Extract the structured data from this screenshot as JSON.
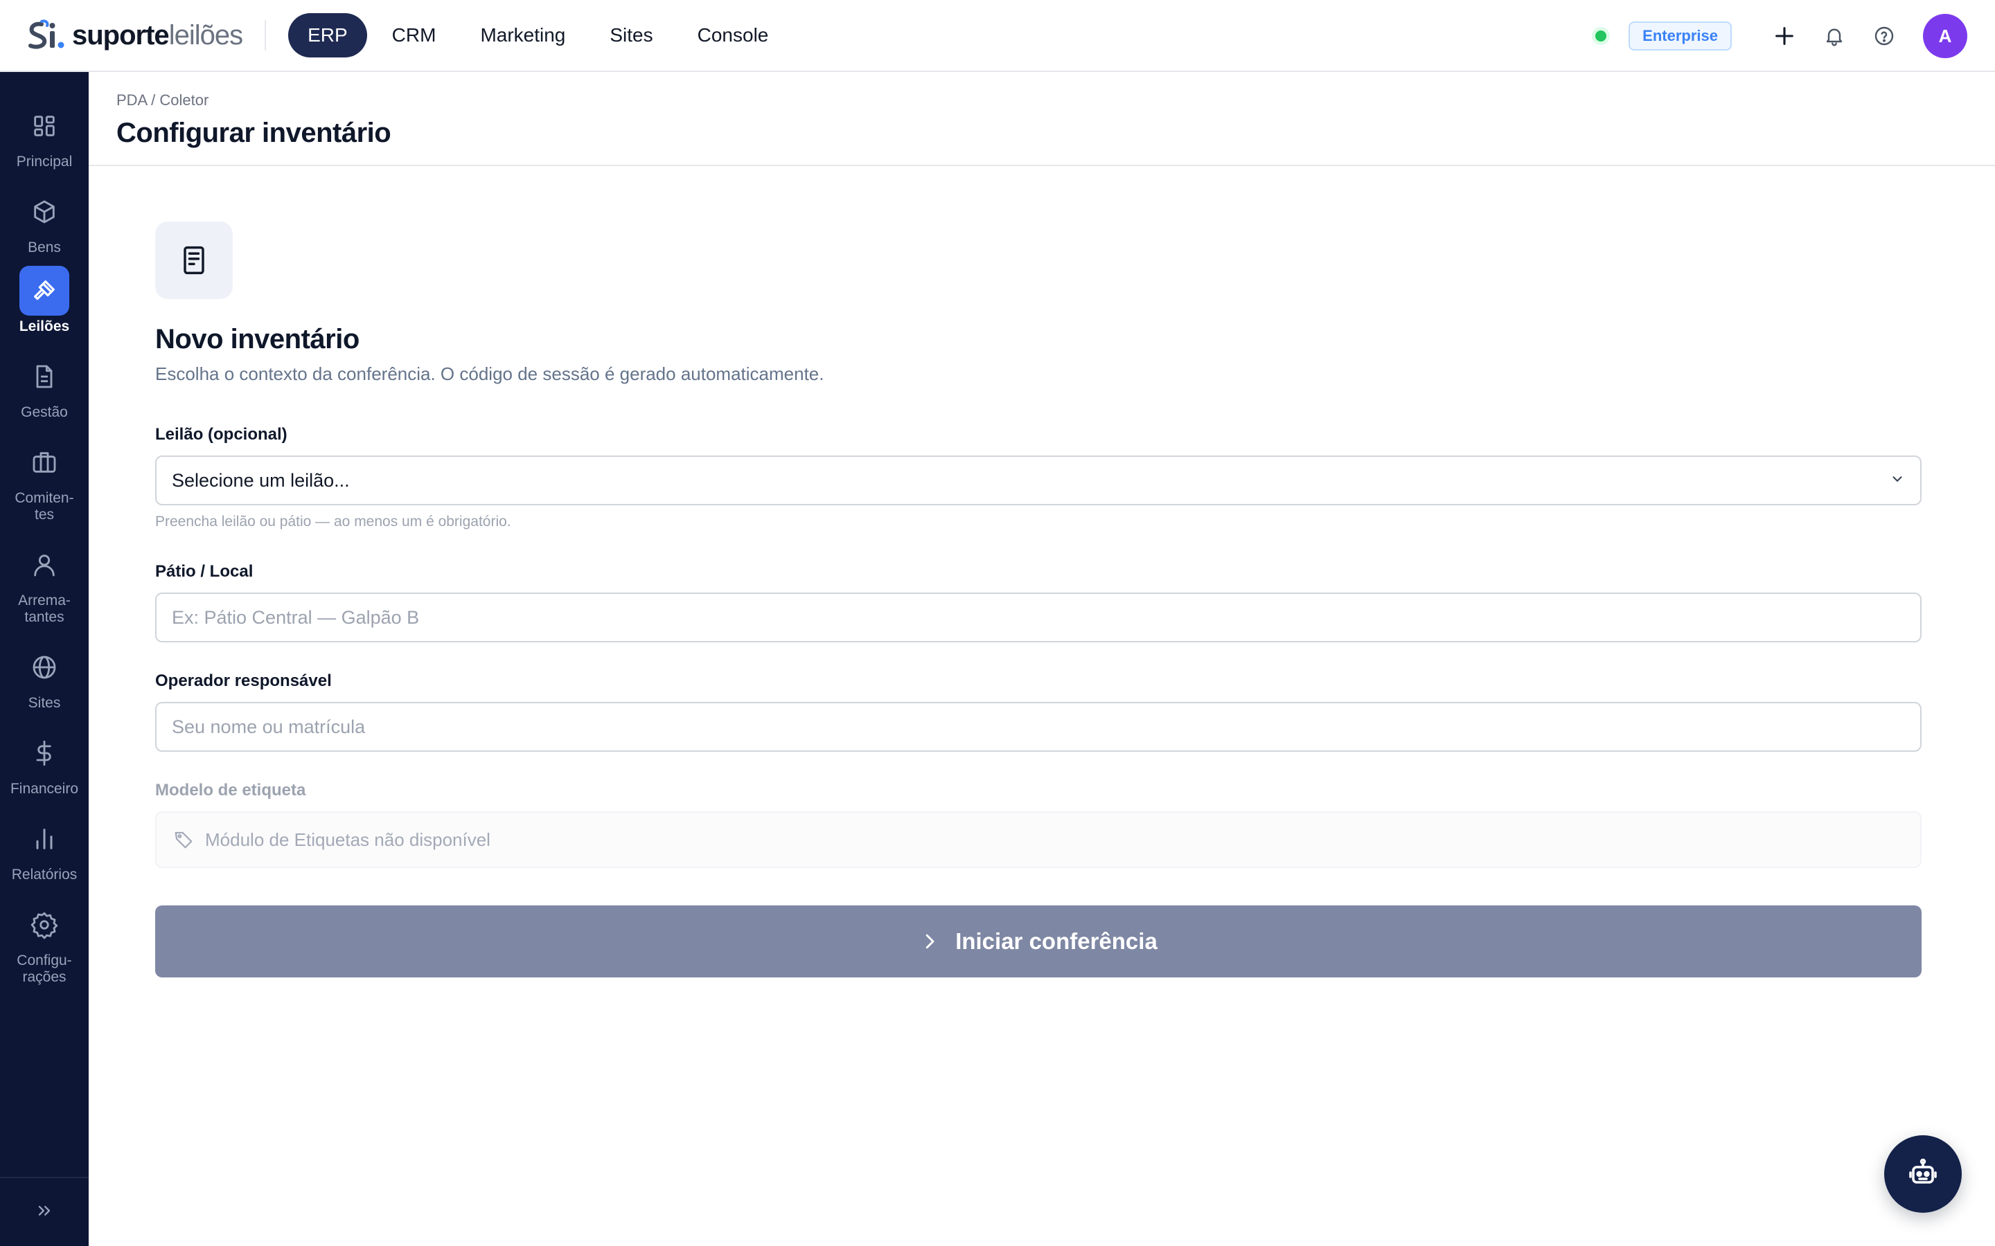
{
  "brand": {
    "logo_mark": "si.",
    "name_bold": "suporte",
    "name_light": "leilões"
  },
  "topnav": [
    {
      "label": "ERP",
      "active": true
    },
    {
      "label": "CRM",
      "active": false
    },
    {
      "label": "Marketing",
      "active": false
    },
    {
      "label": "Sites",
      "active": false
    },
    {
      "label": "Console",
      "active": false
    }
  ],
  "topbar": {
    "plan_badge": "Enterprise",
    "avatar_initial": "A",
    "status_color": "#22c55e",
    "icons": [
      "plus-icon",
      "bell-icon",
      "help-icon"
    ]
  },
  "sidebar": {
    "items": [
      {
        "label": "Principal",
        "icon": "dashboard-grid-icon",
        "active": false
      },
      {
        "label": "Bens",
        "icon": "cube-icon",
        "active": false
      },
      {
        "label": "Leilões",
        "icon": "gavel-icon",
        "active": true
      },
      {
        "label": "Gestão",
        "icon": "document-icon",
        "active": false
      },
      {
        "label": "Comiten-\ntes",
        "icon": "briefcase-icon",
        "active": false
      },
      {
        "label": "Arrema-\ntantes",
        "icon": "user-icon",
        "active": false
      },
      {
        "label": "Sites",
        "icon": "globe-icon",
        "active": false
      },
      {
        "label": "Financeiro",
        "icon": "dollar-icon",
        "active": false
      },
      {
        "label": "Relatórios",
        "icon": "bar-chart-icon",
        "active": false
      },
      {
        "label": "Configu-\nrações",
        "icon": "gear-icon",
        "active": false
      }
    ],
    "collapse_icon": "chevrons-right-icon"
  },
  "page": {
    "breadcrumb": "PDA / Coletor",
    "title": "Configurar inventário"
  },
  "form": {
    "icon": "notepad-icon",
    "title": "Novo inventário",
    "subtitle": "Escolha o contexto da conferência. O código de sessão é gerado automaticamente.",
    "auction": {
      "label": "Leilão (opcional)",
      "selected": "Selecione um leilão...",
      "hint": "Preencha leilão ou pátio — ao menos um é obrigatório."
    },
    "yard": {
      "label": "Pátio / Local",
      "placeholder": "Ex: Pátio Central — Galpão B",
      "value": ""
    },
    "operator": {
      "label": "Operador responsável",
      "placeholder": "Seu nome ou matrícula",
      "value": ""
    },
    "label_model": {
      "label": "Modelo de etiqueta",
      "unavailable_text": "Módulo de Etiquetas não disponível"
    },
    "submit_label": "Iniciar conferência"
  },
  "colors": {
    "sidebar_bg": "#0d1635",
    "accent": "#3b6cf0",
    "nav_active": "#1e2a52",
    "submit_disabled": "#7e87a3",
    "avatar": "#7c3aed"
  },
  "assistant": {
    "icon": "robot-icon"
  }
}
